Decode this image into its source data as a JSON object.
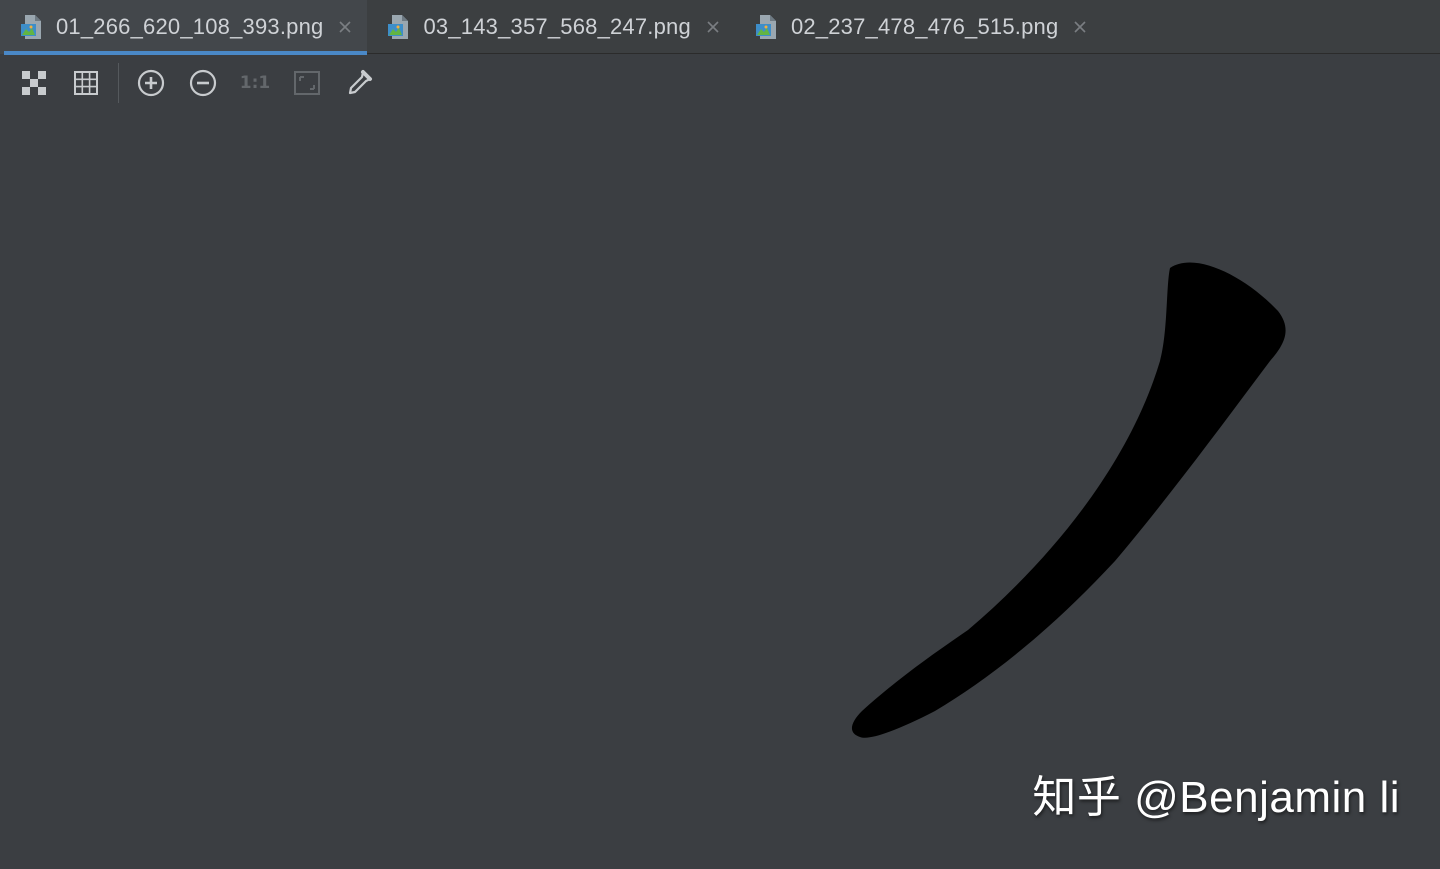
{
  "tabs": [
    {
      "label": "01_266_620_108_393.png",
      "active": true
    },
    {
      "label": "03_143_357_568_247.png",
      "active": false
    },
    {
      "label": "02_237_478_476_515.png",
      "active": false
    }
  ],
  "toolbar": {
    "items": [
      {
        "icon": "chessboard-icon"
      },
      {
        "icon": "grid-icon"
      },
      {
        "icon": "zoom-in-icon"
      },
      {
        "icon": "zoom-out-icon"
      },
      {
        "icon": "actual-size-icon",
        "label": "1:1"
      },
      {
        "icon": "fit-window-icon"
      },
      {
        "icon": "color-picker-icon"
      }
    ]
  },
  "image": {
    "content": "calligraphy stroke (pie)",
    "stroke_color": "#000000"
  },
  "watermark": {
    "text": "知乎 @Benjamin li"
  },
  "colors": {
    "background": "#3b3e42",
    "tab_bar": "#3c3f41",
    "active_tab_underline": "#4a88c7",
    "text": "#cfd2d6"
  }
}
